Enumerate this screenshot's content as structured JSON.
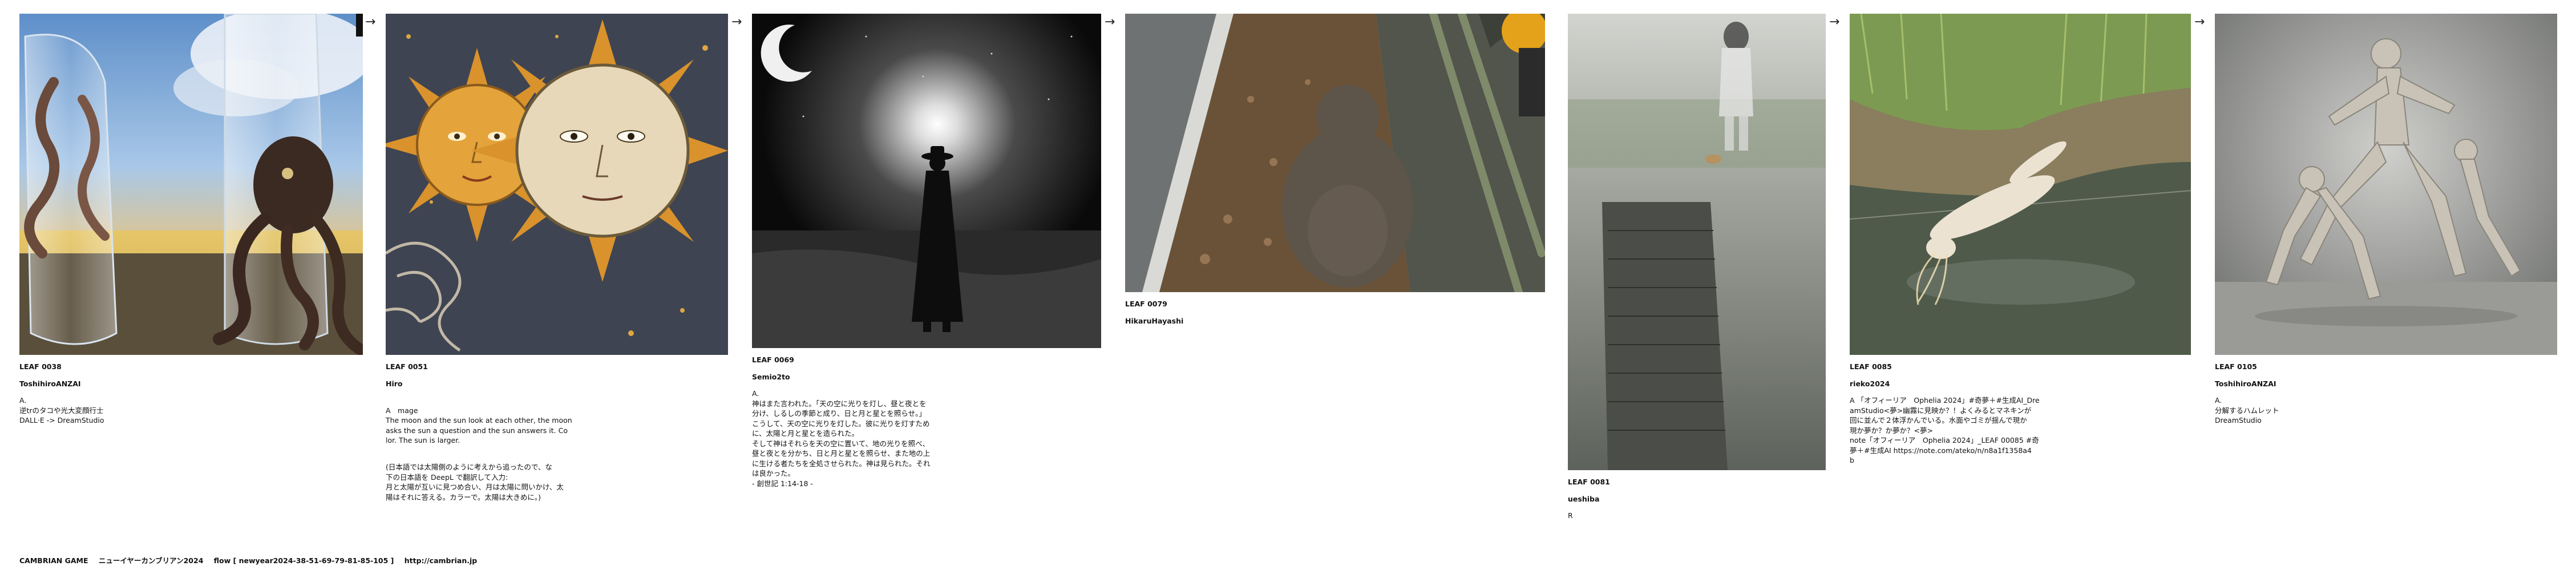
{
  "arrow_glyph": "→",
  "leaves": [
    {
      "id": "LEAF 0038",
      "author": "ToshihiroANZAI",
      "text": "A.\n逆trのタコや光大変顔行士\nDALL·E -> DreamStudio"
    },
    {
      "id": "LEAF 0051",
      "author": "Hiro",
      "text": "A　mage\nThe moon and the sun look at each other, the moon\nasks the sun a question and the sun answers it. Co\nlor. The sun is larger.",
      "text2": "(日本語では太陽側のように考えから追ったので、な\n下の日本語を DeepL で翻訳して入力:\n月と太陽が互いに見つめ合い、月は太陽に問いかけ、太\n陽はそれに答える。カラーで。太陽は大きめに。)"
    },
    {
      "id": "LEAF 0069",
      "author": "Semio2to",
      "text": "A.\n神はまた言われた。「天の空に光りを灯し、昼と夜とを\n分け、しるしの季節と成り、日と月と星とを照らせ。」\nこうして、天の空に光りを灯した。彼に光りを灯すため\nに、太陽と月と星とを造られた。\nそして神はそれらを天の空に置いて、地の光りを照べ、\n昼と夜とを分かち、日と月と星とを照らせ、また地の上\nに生ける者たちを全処させられた。神は見られた。それ\nは良かった。\n- 創世記 1:14-18 -"
    },
    {
      "id": "LEAF 0079",
      "author": "HikaruHayashi",
      "text": ""
    },
    {
      "id": "LEAF 0081",
      "author": "ueshiba",
      "text": "R"
    },
    {
      "id": "LEAF 0085",
      "author": "rieko2024",
      "text": "A 「オフィーリア　Ophelia 2024」#奇夢＋#生成AI_Dre\namStudio<夢>幽霧に見映か？！よくみるとマネキンが\n回に並んで２体浮かんでいる。水面やゴミが揺んで現か\n現か夢か？か夢か？<夢>\nnote「オフィーリア　Ophelia 2024」_LEAF 00085 #奇\n夢＋#生成AI https://note.com/ateko/n/n8a1f1358a4\nb"
    },
    {
      "id": "LEAF 0105",
      "author": "ToshihiroANZAI",
      "text": "A.\n分解するハムレット\nDreamStudio"
    }
  ],
  "footer": {
    "game": "CAMBRIAN GAME",
    "title": "ニューイヤーカンブリアン2024",
    "flow": "flow [ newyear2024-38-51-69-79-81-85-105 ]",
    "url": "http://cambrian.jp"
  }
}
